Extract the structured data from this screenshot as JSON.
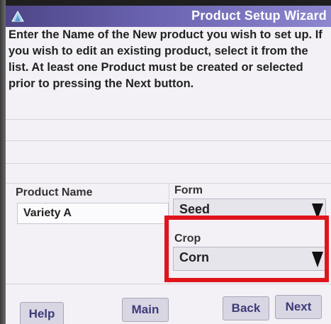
{
  "window": {
    "title": "Product Setup Wizard",
    "logo_icon": "product-logo-icon"
  },
  "instructions": "Enter the Name of the New product you wish to set up. If you wish to edit an existing product, select it from the list. At least one Product must be created or selected prior to pressing the Next button.",
  "product_name": {
    "label": "Product Name",
    "value": "Variety A"
  },
  "form": {
    "label": "Form",
    "value": "Seed"
  },
  "crop": {
    "label": "Crop",
    "value": "Corn"
  },
  "buttons": {
    "help": "Help",
    "main": "Main",
    "back": "Back",
    "next": "Next"
  },
  "colors": {
    "title_bar": "#5a52a0",
    "highlight": "#e0141b",
    "button_text": "#3d3a78"
  }
}
